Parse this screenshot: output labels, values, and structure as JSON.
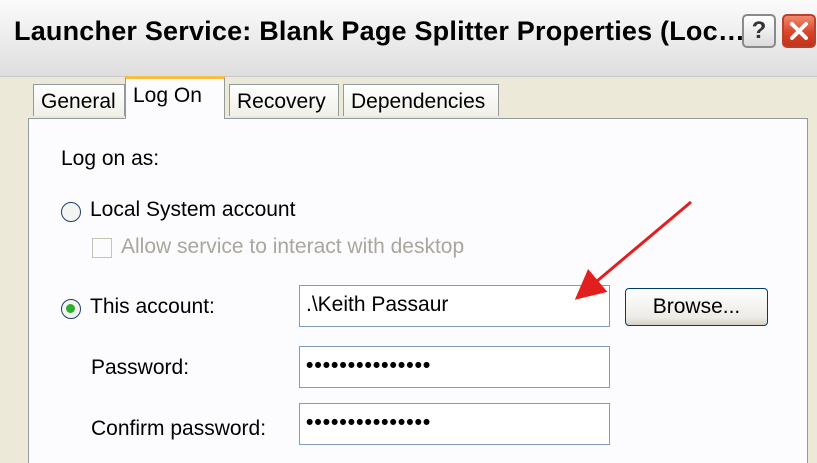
{
  "window": {
    "title": "Launcher Service: Blank Page Splitter Properties (Loc…",
    "help_label": "?"
  },
  "tabs": [
    {
      "label": "General",
      "active": false
    },
    {
      "label": "Log On",
      "active": true
    },
    {
      "label": "Recovery",
      "active": false
    },
    {
      "label": "Dependencies",
      "active": false
    }
  ],
  "logon": {
    "section_label": "Log on as:",
    "local_system_label": "Local System account",
    "local_system_selected": false,
    "interact_desktop_label": "Allow service to interact with desktop",
    "interact_desktop_checked": false,
    "interact_desktop_enabled": false,
    "this_account_label": "This account:",
    "this_account_selected": true,
    "account_value": ".\\Keith Passaur",
    "browse_label": "Browse...",
    "password_label": "Password:",
    "password_value": "•••••••••••••••",
    "confirm_password_label": "Confirm password:",
    "confirm_password_value": "•••••••••••••••"
  },
  "colors": {
    "annotation_arrow": "#e21f1f",
    "selected_tab_accent": "#f7bd43",
    "radio_selected": "#2bb02b"
  }
}
